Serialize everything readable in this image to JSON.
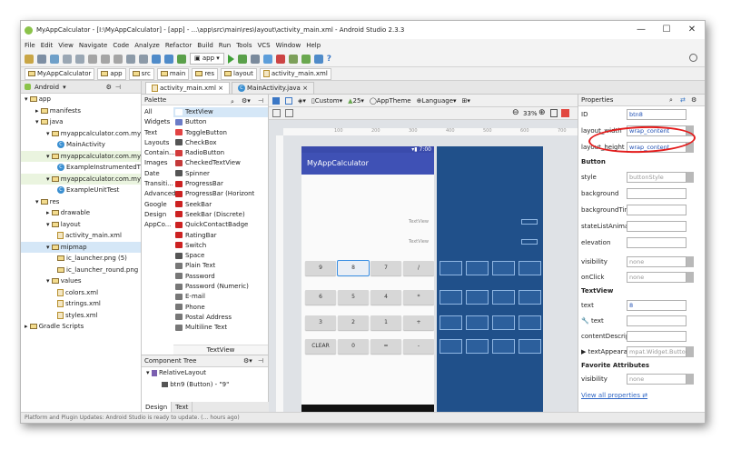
{
  "window": {
    "title": "MyAppCalculator - [I:\\MyAppCalculator] - [app] - ...\\app\\src\\main\\res\\layout\\activity_main.xml - Android Studio 2.3.3",
    "min": "—",
    "max": "☐",
    "close": "✕"
  },
  "menu": [
    "File",
    "Edit",
    "View",
    "Navigate",
    "Code",
    "Analyze",
    "Refactor",
    "Build",
    "Run",
    "Tools",
    "VCS",
    "Window",
    "Help"
  ],
  "toolbar": {
    "run_config": "app",
    "help": "?"
  },
  "breadcrumb": [
    "MyAppCalculator",
    "app",
    "src",
    "main",
    "res",
    "layout",
    "activity_main.xml"
  ],
  "project": {
    "view": "Android",
    "tree": [
      {
        "label": "app",
        "level": 0
      },
      {
        "label": "manifests",
        "level": 1
      },
      {
        "label": "java",
        "level": 1
      },
      {
        "label": "myappcalculator.com.myapp",
        "level": 2
      },
      {
        "label": "MainActivity",
        "level": 3,
        "cls": true
      },
      {
        "label": "myappcalculator.com.myapp",
        "level": 2
      },
      {
        "label": "ExampleInstrumentedT",
        "level": 3,
        "cls": true
      },
      {
        "label": "myappcalculator.com.myapp",
        "level": 2
      },
      {
        "label": "ExampleUnitTest",
        "level": 3,
        "cls": true
      },
      {
        "label": "res",
        "level": 1
      },
      {
        "label": "drawable",
        "level": 2
      },
      {
        "label": "layout",
        "level": 2
      },
      {
        "label": "activity_main.xml",
        "level": 3,
        "xml": true
      },
      {
        "label": "mipmap",
        "level": 2
      },
      {
        "label": "ic_launcher.png (5)",
        "level": 3
      },
      {
        "label": "ic_launcher_round.png (5",
        "level": 3
      },
      {
        "label": "values",
        "level": 2
      },
      {
        "label": "colors.xml",
        "level": 3,
        "xml": true
      },
      {
        "label": "strings.xml",
        "level": 3,
        "xml": true
      },
      {
        "label": "styles.xml",
        "level": 3,
        "xml": true
      },
      {
        "label": "Gradle Scripts",
        "level": 0
      }
    ]
  },
  "editor_tabs": [
    "activity_main.xml",
    "MainActivity.java"
  ],
  "palette": {
    "title": "Palette",
    "categories": [
      "All",
      "Widgets",
      "Text",
      "Layouts",
      "Contain...",
      "Images",
      "Date",
      "Transiti...",
      "Advanced",
      "Google",
      "Design",
      "AppCo..."
    ],
    "items": [
      "TextView",
      "Button",
      "ToggleButton",
      "CheckBox",
      "RadioButton",
      "CheckedTextView",
      "Spinner",
      "ProgressBar",
      "ProgressBar (Horizont",
      "SeekBar",
      "SeekBar (Discrete)",
      "QuickContactBadge",
      "RatingBar",
      "Switch",
      "Space",
      "Plain Text",
      "Password",
      "Password (Numeric)",
      "E-mail",
      "Phone",
      "Postal Address",
      "Multiline Text"
    ],
    "item_colors": [
      "#ffffff",
      "#6b7cc7",
      "#e24343",
      "#555",
      "#d23c3c",
      "#c43a3a",
      "#555",
      "#c22",
      "#c22",
      "#c22",
      "#c22",
      "#c22",
      "#c22",
      "#c22",
      "#555",
      "#777",
      "#777",
      "#777",
      "#777",
      "#777",
      "#777",
      "#777"
    ],
    "preview_label": "TextView"
  },
  "component_tree": {
    "title": "Component Tree",
    "root": "RelativeLayout",
    "child": "btn9 (Button) - \"9\""
  },
  "design_tabs": [
    "Design",
    "Text"
  ],
  "canvas": {
    "device": "Custom",
    "api": "25",
    "theme": "AppTheme",
    "language": "Language",
    "zoom": "33%",
    "ruler": [
      "100",
      "200",
      "300",
      "400",
      "500",
      "600",
      "700"
    ],
    "phone": {
      "time": "7:00",
      "app_title": "MyAppCalculator",
      "textview1": "TextView",
      "textview2": "TextView",
      "rows": [
        [
          "9",
          "8",
          "7",
          "/"
        ],
        [
          "6",
          "5",
          "4",
          "*"
        ],
        [
          "3",
          "2",
          "1",
          "+"
        ],
        [
          "CLEAR",
          "0",
          "=",
          "-"
        ]
      ],
      "selected_key": "8"
    }
  },
  "properties": {
    "title": "Properties",
    "id": "btn8",
    "layout_width": "wrap_content",
    "layout_height": "wrap_content",
    "button_section": "Button",
    "style": "buttonStyle",
    "rows": [
      "background",
      "backgroundTint",
      "stateListAnimator",
      "elevation"
    ],
    "visibility_label": "visibility",
    "visibility": "none",
    "onclick_label": "onClick",
    "onclick": "none",
    "textview_section": "TextView",
    "text_label": "text",
    "text": "8",
    "tool_text_label": "text",
    "content_desc": "contentDescript...",
    "text_appearance_label": "textAppeara...",
    "text_appearance": "mpat.Widget.Button",
    "fav_section": "Favorite Attributes",
    "fav_visibility": "none",
    "view_all": "View all properties"
  },
  "status": "Platform and Plugin Updates: Android Studio is ready to update. (… hours ago)"
}
